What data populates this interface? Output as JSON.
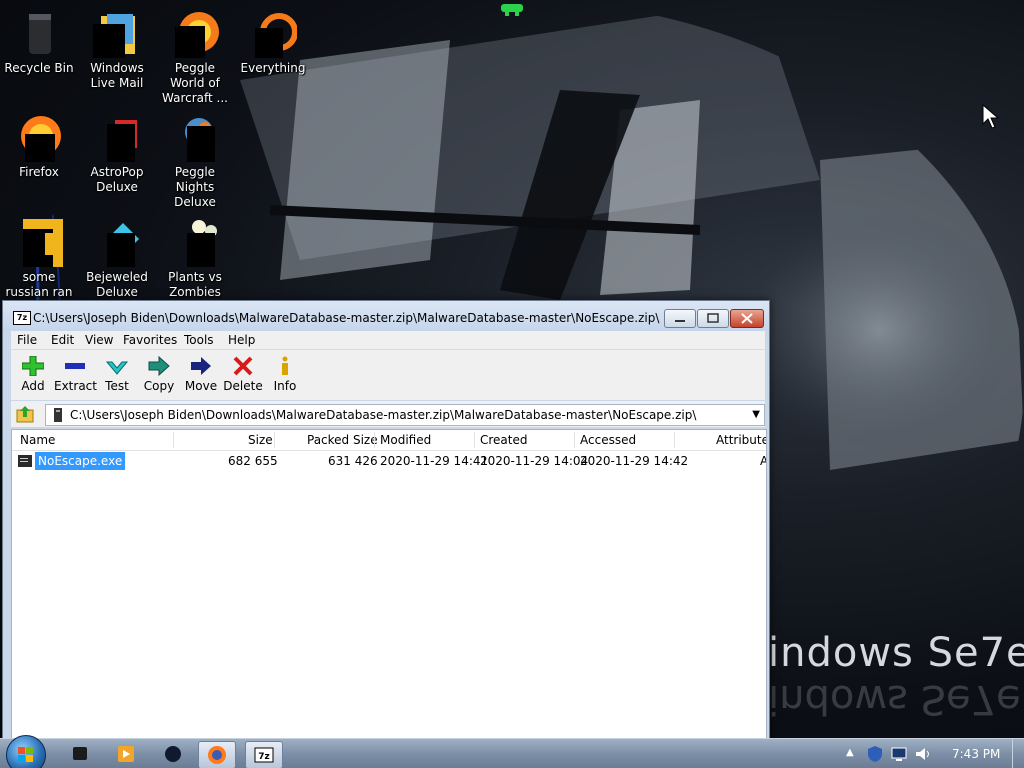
{
  "desktop": {
    "icons": [
      {
        "label": "Recycle Bin",
        "icon": "recycle-bin-icon"
      },
      {
        "label": "Windows Live Mail",
        "icon": "mail-icon"
      },
      {
        "label": "Peggle World of Warcraft ...",
        "icon": "peggle-icon"
      },
      {
        "label": "Everything",
        "icon": "search-icon"
      },
      {
        "label": "Firefox",
        "icon": "firefox-icon"
      },
      {
        "label": "AstroPop Deluxe",
        "icon": "astropop-icon"
      },
      {
        "label": "Peggle Nights Deluxe",
        "icon": "peggle-nights-icon"
      },
      {
        "label": "some russian ran a rat",
        "icon": "java-file-icon"
      },
      {
        "label": "Bejeweled Deluxe",
        "icon": "bejeweled-icon"
      },
      {
        "label": "Plants vs Zombies",
        "icon": "plants-vs-zombies-icon"
      }
    ],
    "wallpaper_brand": "indows Se7en"
  },
  "window": {
    "title": "C:\\Users\\Joseph Biden\\Downloads\\MalwareDatabase-master.zip\\MalwareDatabase-master\\NoEscape.zip\\",
    "menu": [
      "File",
      "Edit",
      "View",
      "Favorites",
      "Tools",
      "Help"
    ],
    "toolbar": [
      {
        "label": "Add",
        "icon": "plus-icon"
      },
      {
        "label": "Extract",
        "icon": "minus-icon"
      },
      {
        "label": "Test",
        "icon": "check-icon"
      },
      {
        "label": "Copy",
        "icon": "copy-arrow-icon"
      },
      {
        "label": "Move",
        "icon": "move-arrow-icon"
      },
      {
        "label": "Delete",
        "icon": "x-icon"
      },
      {
        "label": "Info",
        "icon": "info-icon"
      }
    ],
    "address": "C:\\Users\\Joseph Biden\\Downloads\\MalwareDatabase-master.zip\\MalwareDatabase-master\\NoEscape.zip\\",
    "columns": [
      "Name",
      "Size",
      "Packed Size",
      "Modified",
      "Created",
      "Accessed",
      "Attribute"
    ],
    "files": [
      {
        "name": "NoEscape.exe",
        "size": "682 655",
        "packed": "631 426",
        "modified": "2020-11-29 14:41",
        "created": "2020-11-29 14:04",
        "accessed": "2020-11-29 14:42",
        "attr": "A"
      }
    ]
  },
  "taskbar": {
    "clock": "7:43 PM",
    "items": [
      "cmd-icon",
      "media-player-icon",
      "unknown-app-icon",
      "firefox-icon",
      "7zip-icon"
    ]
  },
  "colors": {
    "selection": "#3399ff",
    "close_button": "#c4432b"
  }
}
